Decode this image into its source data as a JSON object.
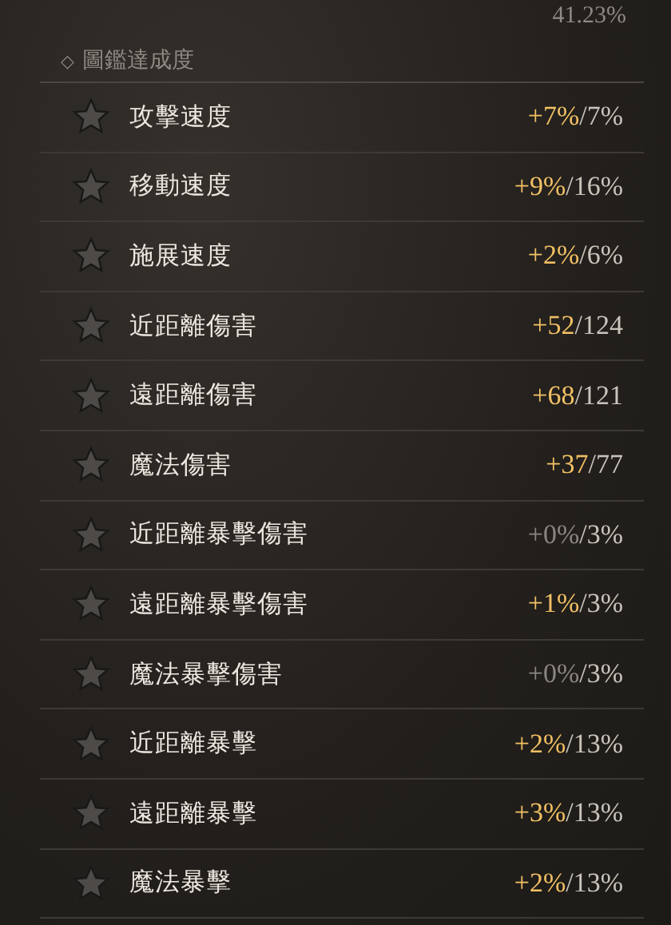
{
  "completion": "41.23%",
  "section": {
    "icon": "◇",
    "title": "圖鑑達成度"
  },
  "stats": [
    {
      "label": "攻擊速度",
      "bonus": "+7%",
      "max": "/7%",
      "active": true
    },
    {
      "label": "移動速度",
      "bonus": "+9%",
      "max": "/16%",
      "active": true
    },
    {
      "label": "施展速度",
      "bonus": "+2%",
      "max": "/6%",
      "active": true
    },
    {
      "label": "近距離傷害",
      "bonus": "+52",
      "max": "/124",
      "active": true
    },
    {
      "label": "遠距離傷害",
      "bonus": "+68",
      "max": "/121",
      "active": true
    },
    {
      "label": "魔法傷害",
      "bonus": "+37",
      "max": "/77",
      "active": true
    },
    {
      "label": "近距離暴擊傷害",
      "bonus": "+0%",
      "max": "/3%",
      "active": false
    },
    {
      "label": "遠距離暴擊傷害",
      "bonus": "+1%",
      "max": "/3%",
      "active": true
    },
    {
      "label": "魔法暴擊傷害",
      "bonus": "+0%",
      "max": "/3%",
      "active": false
    },
    {
      "label": "近距離暴擊",
      "bonus": "+2%",
      "max": "/13%",
      "active": true
    },
    {
      "label": "遠距離暴擊",
      "bonus": "+3%",
      "max": "/13%",
      "active": true
    },
    {
      "label": "魔法暴擊",
      "bonus": "+2%",
      "max": "/13%",
      "active": true
    }
  ]
}
